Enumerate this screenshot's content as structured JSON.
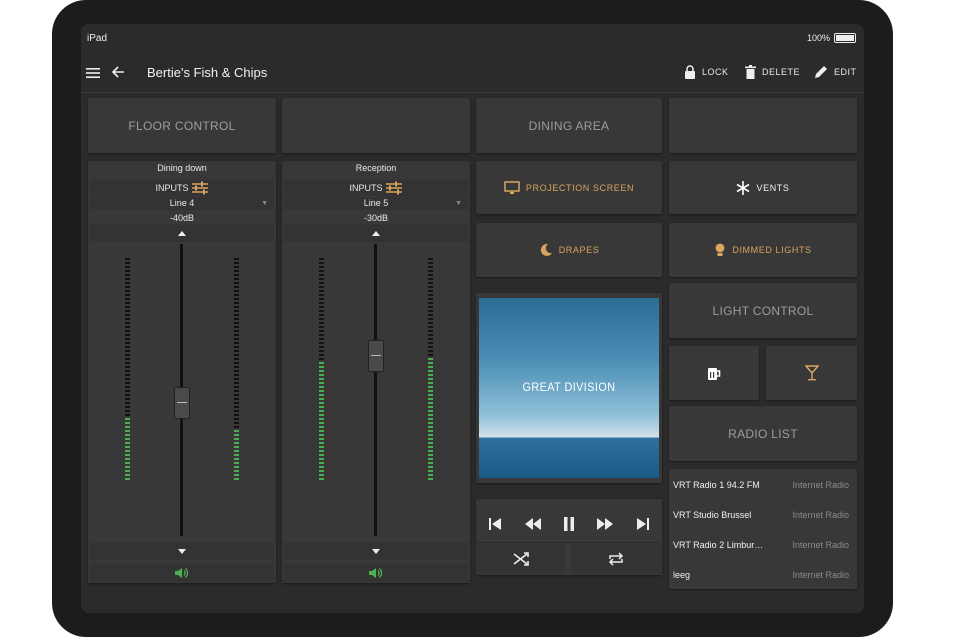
{
  "status": {
    "device": "iPad",
    "battery": "100%"
  },
  "header": {
    "title": "Bertie's Fish & Chips",
    "lock": "LOCK",
    "delete": "DELETE",
    "edit": "EDIT"
  },
  "floor_control": {
    "label": "FLOOR CONTROL"
  },
  "dining_area": {
    "label": "DINING AREA"
  },
  "channels": [
    {
      "name": "Dining down",
      "inputs_label": "INPUTS",
      "input": "Line 4",
      "level": "-40dB",
      "fader_level": 0.46,
      "meter_left": 0.28,
      "meter_right": 0.24
    },
    {
      "name": "Reception",
      "inputs_label": "INPUTS",
      "input": "Line 5",
      "level": "-30dB",
      "fader_level": 0.62,
      "meter_left": 0.54,
      "meter_right": 0.56
    }
  ],
  "buttons": {
    "projection": "PROJECTION SCREEN",
    "vents": "VENTS",
    "drapes": "DRAPES",
    "dimmed": "DIMMED LIGHTS"
  },
  "light_control": {
    "label": "LIGHT CONTROL"
  },
  "album": {
    "title": "GREAT DIVISION"
  },
  "radio": {
    "label": "RADIO LIST",
    "items": [
      {
        "name": "VRT Radio 1 94.2 FM",
        "type": "Internet Radio"
      },
      {
        "name": "VRT Studio Brussel",
        "type": "Internet Radio"
      },
      {
        "name": "VRT Radio 2 Limbur…",
        "type": "Internet Radio"
      },
      {
        "name": "leeg",
        "type": "Internet Radio"
      }
    ]
  },
  "colors": {
    "accent": "#d8a45e",
    "meter": "#4caf50",
    "panel": "#383838"
  }
}
